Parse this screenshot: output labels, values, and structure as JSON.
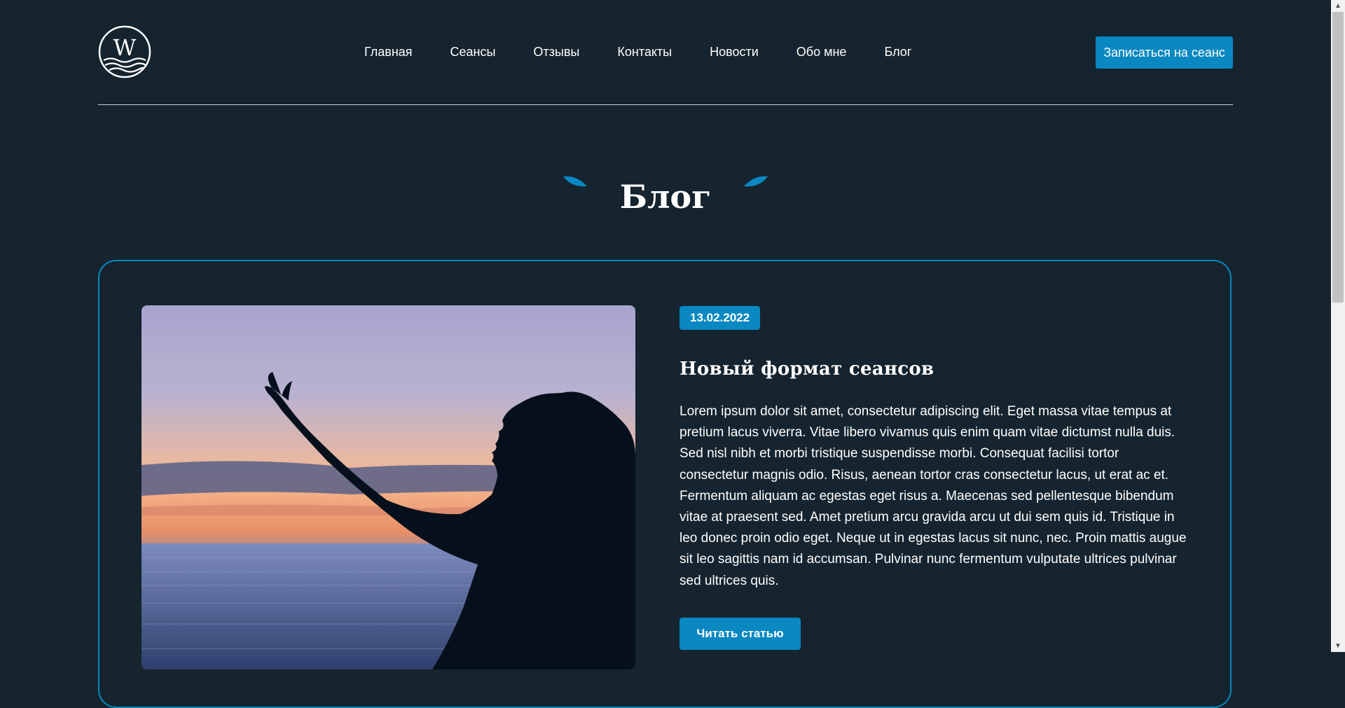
{
  "brand": {
    "logo_letter": "W"
  },
  "nav": {
    "items": [
      {
        "label": "Главная"
      },
      {
        "label": "Сеансы"
      },
      {
        "label": "Отзывы"
      },
      {
        "label": "Контакты"
      },
      {
        "label": "Новости"
      },
      {
        "label": "Обо мне"
      },
      {
        "label": "Блог"
      }
    ]
  },
  "header": {
    "cta_label": "Записаться на сеанс"
  },
  "page": {
    "title": "Блог"
  },
  "post": {
    "date": "13.02.2022",
    "title": "Новый формат сеансов",
    "body": "Lorem ipsum dolor sit amet, consectetur adipiscing elit. Eget massa vitae tempus at pretium lacus viverra. Vitae libero vivamus quis enim quam vitae dictumst nulla duis. Sed nisl nibh et morbi tristique suspendisse morbi. Consequat facilisi tortor consectetur magnis odio. Risus, aenean tortor cras consectetur lacus, ut erat ac et. Fermentum aliquam ac egestas eget risus a. Maecenas sed pellentesque bibendum vitae at praesent sed. Amet pretium arcu gravida arcu ut dui sem quis id. Tristique in leo donec proin odio eget. Neque ut in egestas lacus sit nunc, nec. Proin mattis augue sit leo sagittis nam id accumsan. Pulvinar nunc fermentum vulputate ultrices pulvinar sed ultrices quis.",
    "read_label": "Читать статью"
  },
  "colors": {
    "background": "#15242f",
    "accent": "#0a88c2",
    "text": "#ffffff"
  },
  "icons": {
    "logo": "wave-logo-icon",
    "leaf_left": "leaf-icon",
    "leaf_right": "leaf-icon"
  }
}
